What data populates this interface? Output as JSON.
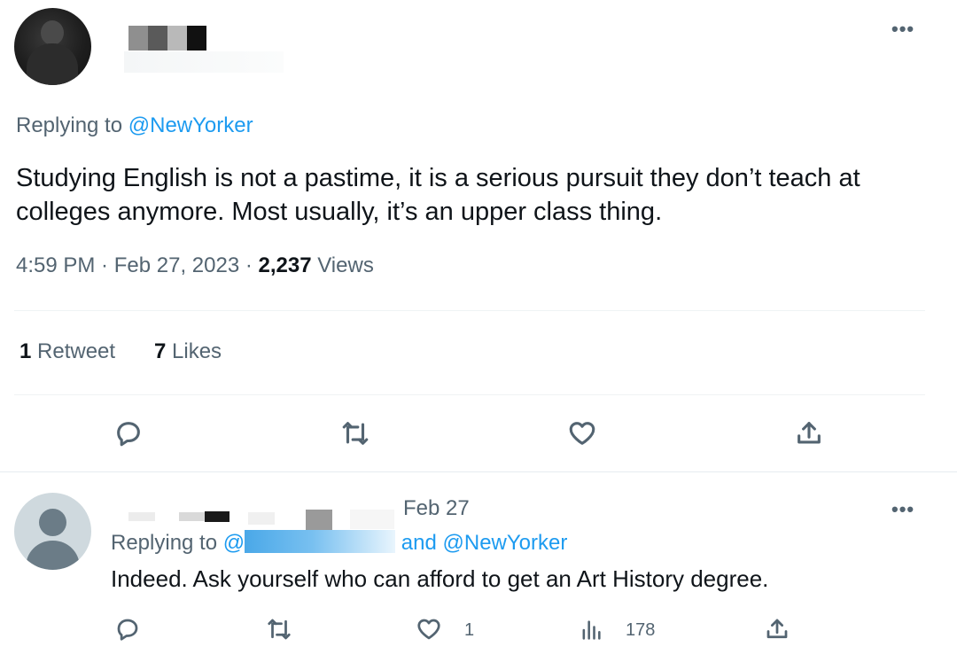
{
  "main_tweet": {
    "menu": "•••",
    "replying_prefix": "Replying to ",
    "replying_handle": "@NewYorker",
    "text": "Studying English is not a pastime, it is a serious pursuit they don’t teach at colleges anymore. Most usually, it’s an upper class thing.",
    "time": "4:59 PM",
    "sep1": " · ",
    "date": "Feb 27, 2023",
    "sep2": " · ",
    "views_count": "2,237",
    "views_label": " Views",
    "retweets_count": "1",
    "retweets_label": " Retweet",
    "likes_count": "7",
    "likes_label": " Likes",
    "actions": [
      "reply-icon",
      "retweet-icon",
      "like-icon",
      "share-icon"
    ]
  },
  "reply_tweet": {
    "date": "Feb 27",
    "menu": "•••",
    "replying_prefix": "Replying to ",
    "replying_handle_start": "@",
    "replying_suffix": " and @NewYorker",
    "text": "Indeed. Ask yourself who can afford to get an Art History degree.",
    "like_count": "1",
    "views_count": "178",
    "actions": [
      "reply-icon",
      "retweet-icon",
      "like-icon",
      "views-icon",
      "share-icon"
    ]
  },
  "colors": {
    "link": "#1d9bf0",
    "secondary_text": "#536471",
    "primary_text": "#0f1419",
    "divider": "#eff3f4",
    "redaction_blue": "#4aa8e8"
  }
}
